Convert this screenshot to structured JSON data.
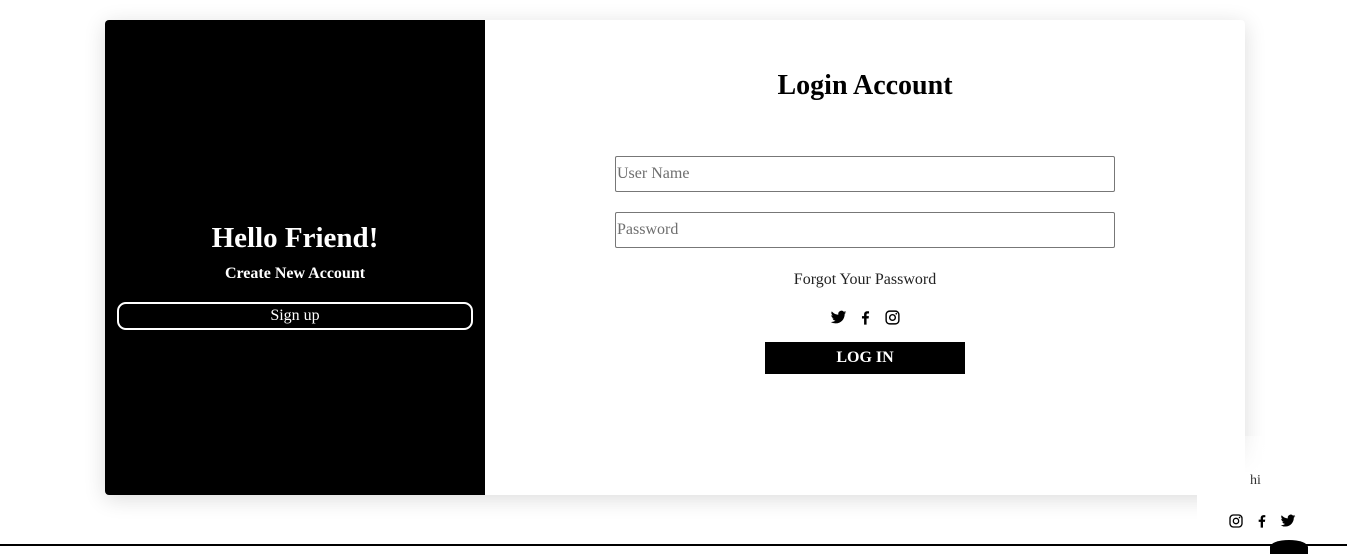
{
  "left_panel": {
    "heading": "Hello Friend!",
    "subheading": "Create New Account",
    "signup_label": "Sign up"
  },
  "form": {
    "title": "Login Account",
    "username": {
      "placeholder": "User Name",
      "value": ""
    },
    "password": {
      "placeholder": "Password",
      "value": ""
    },
    "forgot_label": "Forgot Your Password",
    "social_icons": [
      "twitter-icon",
      "facebook-icon",
      "instagram-icon"
    ],
    "login_label": "LOG IN"
  },
  "corner_widget": {
    "text": "hi",
    "icons": [
      "instagram-icon",
      "facebook-icon",
      "twitter-icon"
    ]
  },
  "colors": {
    "panel": "#000000",
    "button": "#000000",
    "background": "#ffffff"
  }
}
